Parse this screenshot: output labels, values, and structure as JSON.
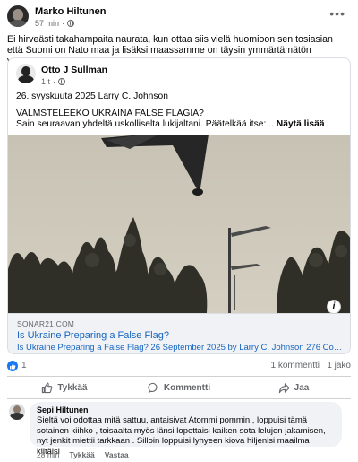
{
  "post": {
    "author": "Marko Hiltunen",
    "time": "57 min",
    "more_glyph": "•••",
    "text": "Ei hirveästi takahampaita naurata, kun ottaa siis vielä huomioon sen tosiasian että Suomi on Nato maa ja lisäksi maassamme on täysin ymmärtämätön virkakoneisto!"
  },
  "shared": {
    "author": "Otto J Sullman",
    "time": "1 t",
    "line1": "26. syyskuuta 2025 Larry C. Johnson",
    "line2": "VALMSTELEEKO UKRAINA FALSE FLAGIA?",
    "line3": "Sain seuraavan yhdeltä uskolliselta lukijaltani. Päätelkää itse:...",
    "see_more": "Näytä lisää"
  },
  "link": {
    "domain": "SONAR21.COM",
    "title": "Is Ukraine Preparing a False Flag?",
    "description": "Is Ukraine Preparing a False Flag? 26 September 2025 by Larry C. Johnson 276 Comm...",
    "info_glyph": "i"
  },
  "stats": {
    "reactions": "1",
    "comments": "1 kommentti",
    "shares": "1 jako"
  },
  "actions": {
    "like": "Tykkää",
    "comment": "Kommentti",
    "share": "Jaa"
  },
  "comment": {
    "author": "Sepi Hiltunen",
    "text": "Sieltä voi odottaa mitä sattuu, antaisivat Atommi pommin , loppuisi tämä sotainen kiihko , toisaalta myös länsi lopettaisi kaiken sota lelujen jakamisen, nyt jenkit miettii tarkkaan . Silloin loppuisi lyhyeen kiova hiljenisi maailma kiitäisi",
    "time": "28 min",
    "like": "Tykkää",
    "reply": "Vastaa"
  },
  "colors": {
    "link_blue": "#1665c0",
    "like_blue": "#1877f2",
    "muted_gray": "#65676b",
    "bubble_bg": "#f0f2f5"
  }
}
